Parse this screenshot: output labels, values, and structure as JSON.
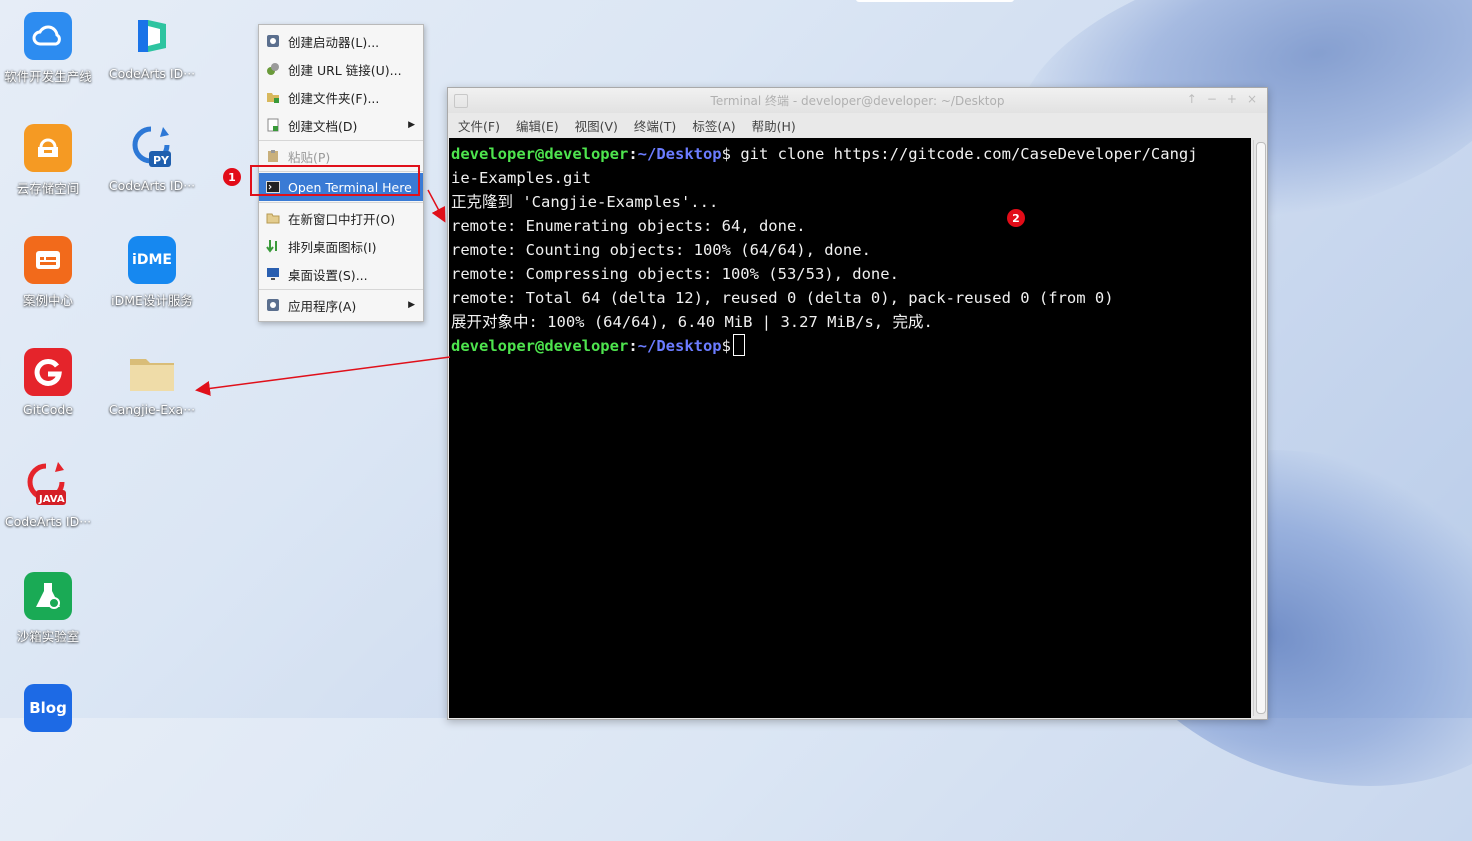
{
  "desktop": {
    "icons": [
      {
        "label": "软件开发生产线",
        "icon": "cloud-devline-icon",
        "color": "#2d8cf0"
      },
      {
        "label": "CodeArts ID···",
        "icon": "codearts-ide-icon",
        "color": "#1a73e8"
      },
      {
        "label": "云存储空间",
        "icon": "cloud-storage-icon",
        "color": "#f59a23"
      },
      {
        "label": "CodeArts ID···",
        "icon": "codearts-python-icon",
        "color": "#1f5fae"
      },
      {
        "label": "案例中心",
        "icon": "case-center-icon",
        "color": "#f26a1b"
      },
      {
        "label": "iDME设计服务",
        "icon": "idme-icon",
        "color": "#1688f0"
      },
      {
        "label": "GitCode",
        "icon": "gitcode-icon",
        "color": "#e5242b"
      },
      {
        "label": "Cangjie-Exa···",
        "icon": "folder-icon",
        "color": "#e9d29a"
      },
      {
        "label": "CodeArts ID···",
        "icon": "codearts-java-icon",
        "color": "#e5242b"
      },
      {
        "label": "沙箱实验室",
        "icon": "sandbox-lab-icon",
        "color": "#1aaa55"
      },
      {
        "label": "Blog",
        "icon": "blog-icon",
        "color": "#1d6ae5"
      }
    ],
    "icon_glyphs": {
      "py": "PY",
      "java": "JAVA",
      "idme": "iDME",
      "blog": "Blog"
    }
  },
  "context_menu": {
    "items": [
      {
        "label": "创建启动器(L)...",
        "icon": "gear-icon"
      },
      {
        "label": "创建 URL 链接(U)...",
        "icon": "link-icon"
      },
      {
        "label": "创建文件夹(F)...",
        "icon": "new-folder-icon"
      },
      {
        "label": "创建文档(D)",
        "icon": "new-document-icon"
      },
      {
        "label": "粘贴(P)",
        "icon": "paste-icon"
      },
      {
        "label": "Open Terminal Here",
        "icon": "terminal-icon"
      },
      {
        "label": "在新窗口中打开(O)",
        "icon": "folder-open-icon"
      },
      {
        "label": "排列桌面图标(I)",
        "icon": "sort-icon"
      },
      {
        "label": "桌面设置(S)...",
        "icon": "monitor-icon"
      },
      {
        "label": "应用程序(A)",
        "icon": "apps-icon"
      }
    ]
  },
  "annotations": {
    "badge1": "1",
    "badge2": "2",
    "highlight_color": "#e0101a"
  },
  "terminal": {
    "title": "Terminal 终端 - developer@developer: ~/Desktop",
    "menu": [
      "文件(F)",
      "编辑(E)",
      "视图(V)",
      "终端(T)",
      "标签(A)",
      "帮助(H)"
    ],
    "prompt_user": "developer@developer",
    "prompt_path": "~/Desktop",
    "command": " git clone https://gitcode.com/CaseDeveloper/Cangj",
    "lines": [
      "ie-Examples.git",
      "正克隆到 'Cangjie-Examples'...",
      "remote: Enumerating objects: 64, done.",
      "remote: Counting objects: 100% (64/64), done.",
      "remote: Compressing objects: 100% (53/53), done.",
      "remote: Total 64 (delta 12), reused 0 (delta 0), pack-reused 0 (from 0)",
      "展开对象中: 100% (64/64), 6.40 MiB | 3.27 MiB/s, 完成."
    ],
    "colors": {
      "user": "#4ee44e",
      "path": "#6b7cff",
      "text": "#f0f0f0",
      "bg": "#000000"
    }
  }
}
